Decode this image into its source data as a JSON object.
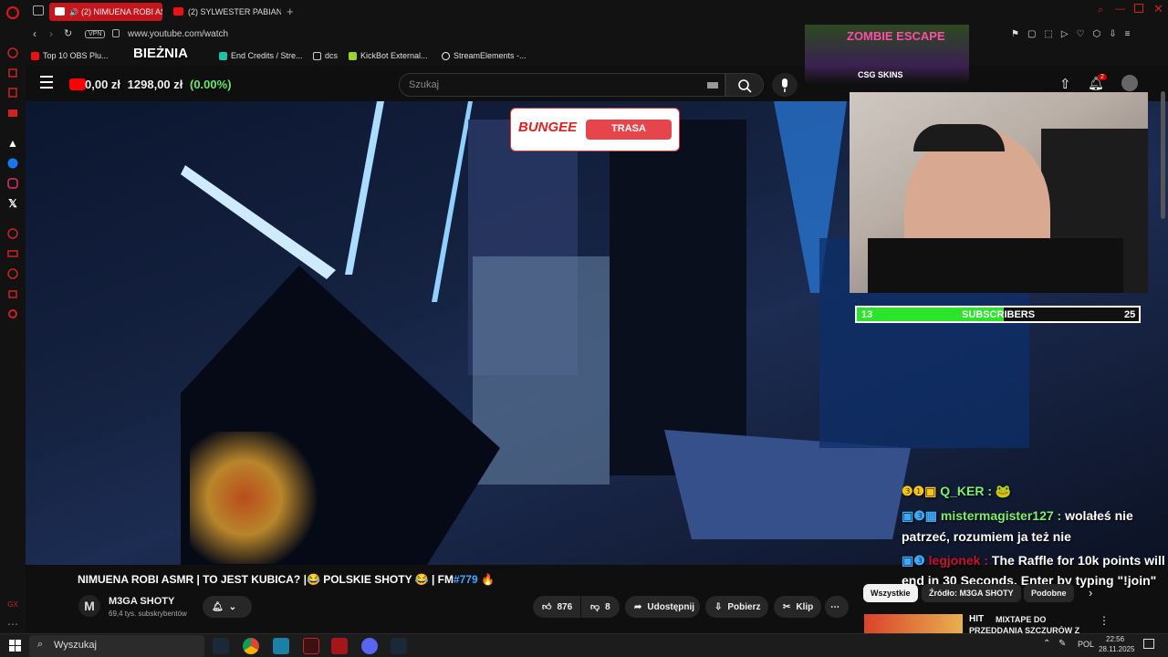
{
  "browser": {
    "tabs": [
      {
        "label": "(2) NIMUENA ROBI AS",
        "active": true
      },
      {
        "label": "(2) SYLWESTER PABIANI",
        "active": false
      }
    ],
    "vpn_badge": "VPN",
    "url": "www.youtube.com/watch",
    "bookmarks": [
      "Top 10 OBS Plu...",
      "End Credits / Stre...",
      "dcs",
      "KickBot External...",
      "StreamElements -..."
    ]
  },
  "overlay": {
    "running_label": "BIEŻNIA",
    "money_left": "0,00 zł",
    "money_right": "1298,00 zł",
    "money_pct": "(0.00%)",
    "bungee_logo": "BUNGEE",
    "bungee_tag": "TRASA",
    "ad_title": "ZOMBIE ESCAPE",
    "ad_subtitle": "CSG SKINS",
    "subs_current": "13",
    "subs_label": "SUBSCRIBERS",
    "subs_goal": "25",
    "subs_progress": 0.52,
    "chat": [
      {
        "user": "Q_KER :",
        "text": "",
        "color": "#7cf06b"
      },
      {
        "user": "mistermagister127 :",
        "text": "wolałeś nie",
        "color": "#7cf06b"
      },
      {
        "user": "",
        "text": "patrzeć, rozumiem ja też nie",
        "color": "#ffffff"
      },
      {
        "user": "legjonek :",
        "text": "The Raffle for 10k points will",
        "color": "#c8102e"
      },
      {
        "user": "",
        "text": "end in 30 Seconds. Enter by typing \"!join\"",
        "color": "#ffffff"
      }
    ]
  },
  "youtube": {
    "search_placeholder": "Szukaj",
    "notification_count": "2",
    "video_title_pre": "NIMUENA ROBI ASMR | TO JEST KUBICA? |😂 POLSKIE SHOTY 😂 | FM",
    "video_title_hashtag": "#779",
    "video_title_post": "🔥",
    "channel_name": "M3GA SHOTY",
    "channel_subs": "69,4 tys. subskrybentów",
    "likes": "876",
    "dislikes": "8",
    "share_label": "Udostępnij",
    "download_label": "Pobierz",
    "clip_label": "Klip",
    "chips": [
      "Wszystkie",
      "Źródło: M3GA SHOTY",
      "Podobne"
    ],
    "suggested_title_line1": "MIXTAPE DO",
    "suggested_title_line2": "PRZEDDANIA SZCZURÓW Z",
    "suggested_thumb_text": "HIT"
  },
  "taskbar": {
    "search_label": "Wyszukaj",
    "lang": "POL",
    "time": "22:56",
    "date": "28.11.2025"
  }
}
